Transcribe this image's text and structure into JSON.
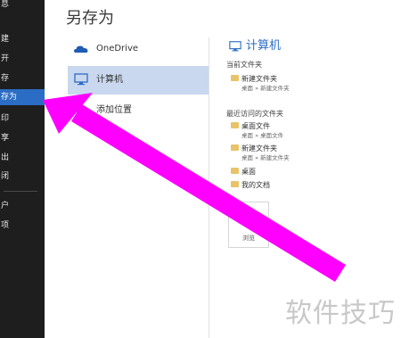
{
  "sidebar": {
    "items": [
      {
        "label": "息"
      },
      {
        "label": "建"
      },
      {
        "label": "开"
      },
      {
        "label": "存"
      },
      {
        "label": "存为"
      },
      {
        "label": "印"
      },
      {
        "label": "享"
      },
      {
        "label": "出"
      },
      {
        "label": "闭"
      },
      {
        "label": "户"
      },
      {
        "label": "项"
      }
    ],
    "active_index": 4
  },
  "page_title": "另存为",
  "locations": [
    {
      "label": "OneDrive",
      "icon": "cloud-icon"
    },
    {
      "label": "计算机",
      "icon": "computer-icon",
      "selected": true
    },
    {
      "label": "添加位置",
      "icon": "add-icon"
    }
  ],
  "right_panel": {
    "title": "计算机",
    "current_folder_label": "当前文件夹",
    "current_folders": [
      {
        "name": "新建文件夹",
        "path": "桌面 » 新建文件夹"
      }
    ],
    "recent_folders_label": "最近访问的文件夹",
    "recent_folders": [
      {
        "name": "桌面文件",
        "path": "桌面 » 桌面文件"
      },
      {
        "name": "新建文件夹",
        "path": "桌面 » 新建文件夹"
      },
      {
        "name": "桌面",
        "path": ""
      },
      {
        "name": "我的文档",
        "path": ""
      }
    ],
    "browse_label": "浏览"
  },
  "watermark": "软件技巧",
  "colors": {
    "accent": "#2b6cc4",
    "sidebar_bg": "#1e1e1e",
    "selected_bg": "#c9d7ef",
    "annotation_arrow": "#ff00ff"
  }
}
